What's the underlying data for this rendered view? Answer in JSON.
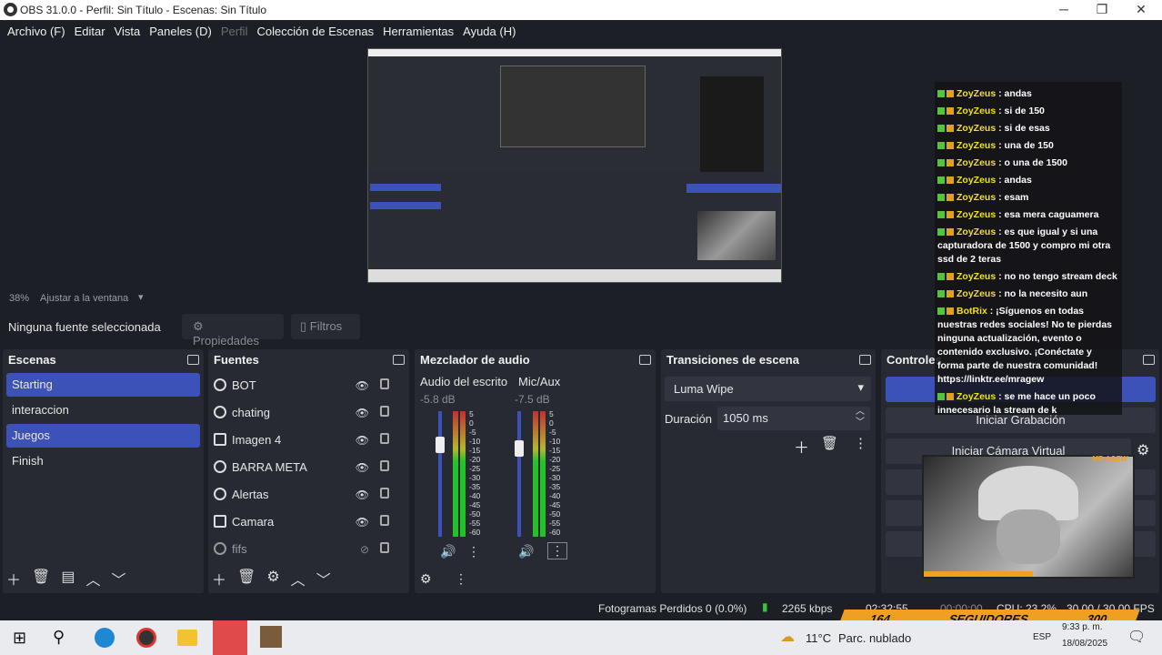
{
  "window": {
    "title": "OBS 31.0.0 - Perfil: Sin Título - Escenas: Sin Título"
  },
  "menu": [
    "Archivo (F)",
    "Editar",
    "Vista",
    "Paneles (D)",
    "Perfil",
    "Colección de Escenas",
    "Herramientas",
    "Ayuda (H)"
  ],
  "zoom": {
    "percent": "38%",
    "fit": "Ajustar a la ventana"
  },
  "source_bar": {
    "none": "Ninguna fuente seleccionada",
    "props": "Propiedades",
    "filters": "Filtros"
  },
  "panels": {
    "scenes": {
      "title": "Escenas",
      "items": [
        "Starting",
        "interaccion",
        "Juegos",
        "Finish"
      ]
    },
    "sources": {
      "title": "Fuentes",
      "items": [
        "BOT",
        "chating",
        "Imagen 4",
        "BARRA META",
        "Alertas",
        "Camara",
        "fifs"
      ]
    },
    "mixer": {
      "title": "Mezclador de audio",
      "channels": [
        {
          "name": "Audio del escrito",
          "db": "-5.8 dB"
        },
        {
          "name": "Mic/Aux",
          "db": "-7.5 dB"
        }
      ],
      "scale": [
        "5",
        "0",
        "-5",
        "-10",
        "-15",
        "-20",
        "-25",
        "-30",
        "-35",
        "-40",
        "-45",
        "-50",
        "-55",
        "-60"
      ]
    },
    "transitions": {
      "title": "Transiciones de escena",
      "selected": "Luma Wipe",
      "duration_label": "Duración",
      "duration_value": "1050 ms"
    },
    "controls": {
      "title": "Controles",
      "record": "Iniciar Grabación",
      "vcam": "Iniciar Cámara Virtual"
    }
  },
  "status": {
    "dropped": "Fotogramas Perdidos 0 (0.0%)",
    "kbps": "2265 kbps",
    "time1": "02:32:55",
    "time2": "00:00:00",
    "cpu": "CPU: 23.2%",
    "fps": "30.00 / 30.00 FPS"
  },
  "chat": [
    {
      "user": "ZoyZeus",
      "text": ": andas"
    },
    {
      "user": "ZoyZeus",
      "text": ": si de 150"
    },
    {
      "user": "ZoyZeus",
      "text": ": si de esas"
    },
    {
      "user": "ZoyZeus",
      "text": ": una de 150"
    },
    {
      "user": "ZoyZeus",
      "text": ": o una de 1500"
    },
    {
      "user": "ZoyZeus",
      "text": ": andas"
    },
    {
      "user": "ZoyZeus",
      "text": ": esam"
    },
    {
      "user": "ZoyZeus",
      "text": ": esa mera caguamera"
    },
    {
      "user": "ZoyZeus",
      "text": ": es que igual y si una capturadora de 1500 y compro mi otra ssd de 2 teras"
    },
    {
      "user": "ZoyZeus",
      "text": ": no no tengo stream deck"
    },
    {
      "user": "ZoyZeus",
      "text": ": no la necesito aun"
    },
    {
      "user": "BotRix",
      "text": ": ¡Síguenos en todas nuestras redes sociales! No te pierdas ninguna actualización, evento o contenido exclusivo. ¡Conéctate y forma parte de nuestra comunidad! https://linktr.ee/mragew"
    },
    {
      "user": "ZoyZeus",
      "text": ": se me hace un poco innecesario la stream de k"
    }
  ],
  "overlay": {
    "followers_now": "164",
    "followers_label": "SEGUIDORES",
    "followers_goal": "300",
    "webcam_tag": "MR AGEW"
  },
  "taskbar": {
    "weather": "11°C",
    "weather_text": "Parc. nublado",
    "lang": "ESP",
    "time": "9:33 p. m.",
    "date": "18/08/2025"
  }
}
